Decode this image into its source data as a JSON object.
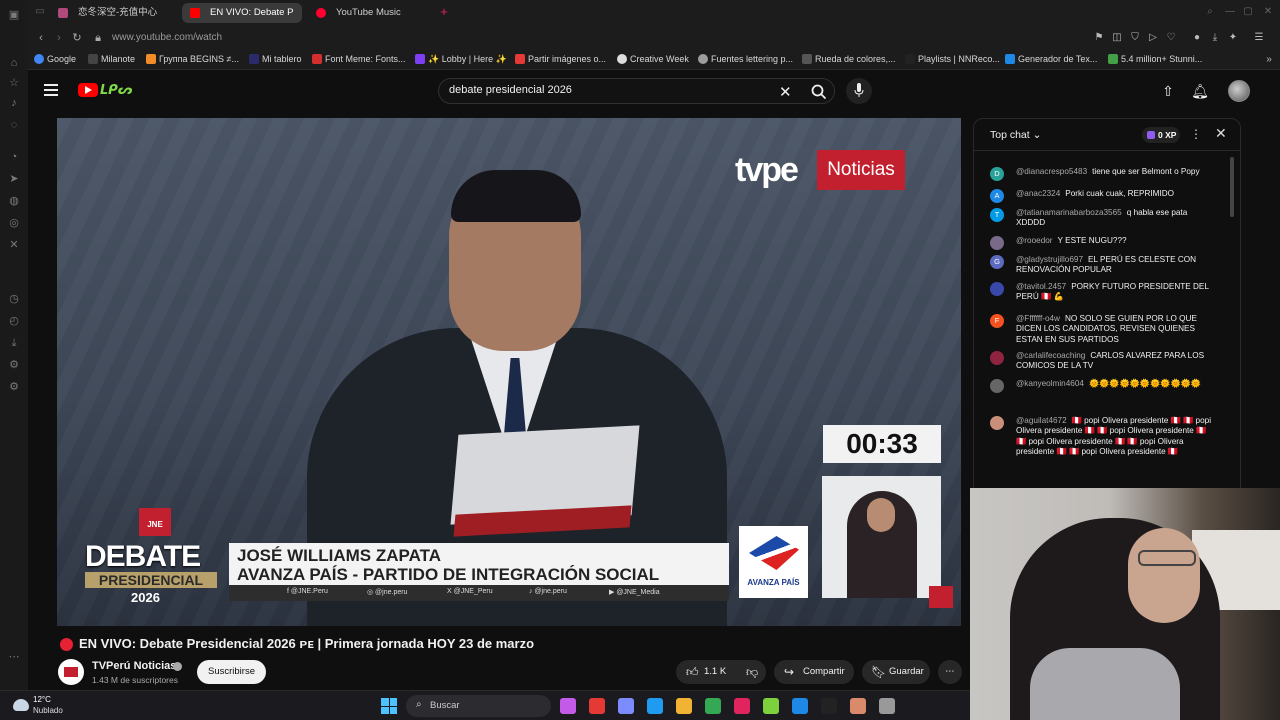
{
  "tabs": [
    {
      "label": "恋冬深空-充值中心",
      "color": "#b04a7a"
    },
    {
      "label": "EN VIVO: Debate P",
      "color": "#ff0000"
    },
    {
      "label": "YouTube Music",
      "color": "#ff0033"
    }
  ],
  "address": {
    "url": "www.youtube.com/watch"
  },
  "bookmarks": [
    {
      "label": "Google",
      "color": "#4285f4"
    },
    {
      "label": "Milanote",
      "color": "#333333"
    },
    {
      "label": "Группа BEGINS ≠...",
      "color": "#f28c28"
    },
    {
      "label": "Mi tablero",
      "color": "#2b2b6b"
    },
    {
      "label": "Font Meme: Fonts...",
      "color": "#d32f2f"
    },
    {
      "label": "✨ Lobby | Here ✨",
      "color": "#7e3ff2"
    },
    {
      "label": "Partir imágenes o...",
      "color": "#e53935"
    },
    {
      "label": "Creative Week",
      "color": "#dddddd"
    },
    {
      "label": "Fuentes lettering p...",
      "color": "#9e9e9e"
    },
    {
      "label": "Rueda de colores,...",
      "color": "#555555"
    },
    {
      "label": "Playlists | NNReco...",
      "color": "#222222"
    },
    {
      "label": "Generador de Tex...",
      "color": "#1e88e5"
    },
    {
      "label": "5.4 million+ Stunni...",
      "color": "#43a047"
    }
  ],
  "yt_header": {
    "doodle": "ᒪᑭᔕ",
    "search_value": "debate presidencial 2026",
    "search_placeholder": "Buscar"
  },
  "player": {
    "tvpe_brand": "tvpe",
    "tvpe_label": "Noticias",
    "timer": "00:33",
    "jne_badge": "JNE",
    "debate_word": "DEBATE",
    "pres_word": "PRESIDENCIAL",
    "year_word": "2026",
    "candidate_name": "JOSÉ WILLIAMS ZAPATA",
    "candidate_party": "AVANZA PAÍS - PARTIDO DE INTEGRACIÓN SOCIAL",
    "party_logo_text": "AVANZA PAÍS",
    "socials": [
      "f  @JNE.Peru",
      "◎  @jne.peru",
      "X  @JNE_Peru",
      "♪  @jne.peru",
      "▶  @JNE_Media"
    ]
  },
  "video": {
    "title": "EN VIVO: Debate Presidencial 2026 ᴘᴇ | Primera jornada HOY 23 de marzo",
    "channel": "TVPerú Noticias",
    "subscribers": "1.43 M de suscriptores",
    "subscribe_label": "Suscribirse",
    "likes": "1.1 K",
    "share_label": "Compartir",
    "save_label": "Guardar"
  },
  "chat": {
    "title": "Top chat",
    "xp": "0 XP",
    "messages": [
      {
        "initial": "D",
        "color": "#2aa198",
        "author": "@dianacrespo5483",
        "text": "tiene que ser Belmont o Popy"
      },
      {
        "initial": "A",
        "color": "#1e88e5",
        "author": "@anac2324",
        "text": "Porki cuak cuak, REPRIMIDO"
      },
      {
        "initial": "T",
        "color": "#039be5",
        "author": "@tatianamarinabarboza3565",
        "text": "q habla ese pata XDDDD"
      },
      {
        "initial": "",
        "color": "#7a6a8a",
        "author": "@rooedor",
        "text": "Y ESTE NUGU???"
      },
      {
        "initial": "G",
        "color": "#5c6bc0",
        "author": "@gladystrujillo697",
        "text": "EL PERÚ ES CELESTE CON RENOVACIÓN POPULAR"
      },
      {
        "initial": "",
        "color": "#3949ab",
        "author": "@tavitol.2457",
        "text": "PORKY FUTURO PRESIDENTE DEL PERÚ 🇵🇪 💪"
      },
      {
        "initial": "F",
        "color": "#f4511e",
        "author": "@Fffffff-o4w",
        "text": "NO SOLO SE GUIEN POR LO QUE DICEN LOS CANDIDATOS, REVISEN QUIENES ESTAN EN SUS PARTIDOS"
      },
      {
        "initial": "",
        "color": "#8e2440",
        "author": "@carlalifecoaching",
        "text": "CARLOS ALVAREZ PARA LOS COMICOS DE LA TV"
      },
      {
        "initial": "",
        "color": "#666666",
        "author": "@kanyeolmin4604",
        "text": "🌞🌞🌞🌞🌞🌞🌞🌞🌞🌞🌞"
      },
      {
        "initial": "",
        "color": "#c98f7a",
        "author": "@aguilat4672",
        "text": "🇵🇪 popi Olivera presidente 🇵🇪 🇵🇪 popi Olivera presidente 🇵🇪 🇵🇪 popi Olivera presidente 🇵🇪 🇵🇪 popi Olivera presidente 🇵🇪 🇵🇪 popi Olivera presidente 🇵🇪 🇵🇪 popi Olivera presidente 🇵🇪"
      }
    ]
  },
  "taskbar": {
    "temp": "12°C",
    "weather": "Nublado",
    "search_label": "Buscar",
    "apps": [
      "#c45ae8",
      "#e53935",
      "#7c8cff",
      "#1f9bf0",
      "#f2b233",
      "#34a853",
      "#e0245e",
      "#7bd23c",
      "#1e88e5",
      "#222222",
      "#d88a6a",
      "#999999"
    ]
  }
}
